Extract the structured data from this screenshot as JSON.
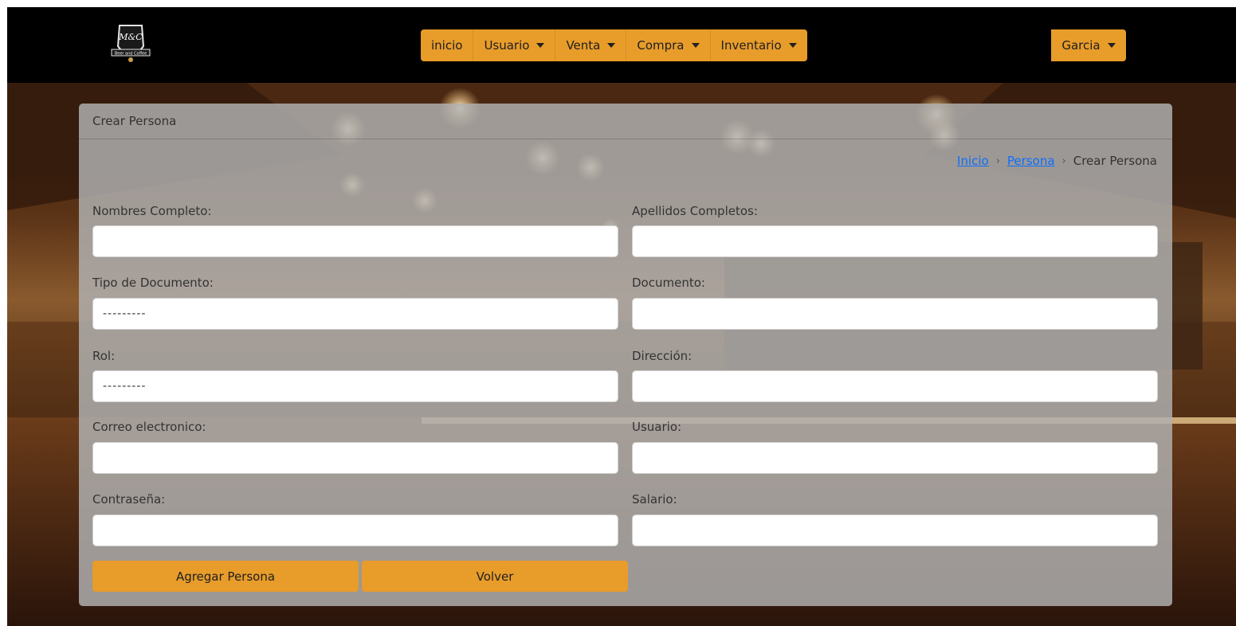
{
  "nav": {
    "items": [
      "inicio",
      "Usuario",
      "Venta",
      "Compra",
      "Inventario"
    ],
    "user_label": "Garcia",
    "accent": "#e89c2a"
  },
  "logo": {
    "text": "M&C",
    "subtext": "Beer and Coffee"
  },
  "card": {
    "header": "Crear Persona",
    "breadcrumb": {
      "home": "Inicio",
      "parent": "Persona",
      "current": "Crear Persona"
    }
  },
  "form": {
    "nombres_label": "Nombres Completo:",
    "apellidos_label": "Apellidos Completos:",
    "tipo_doc_label": "Tipo de Documento:",
    "tipo_doc_value": "---------",
    "documento_label": "Documento:",
    "rol_label": "Rol:",
    "rol_value": "---------",
    "direccion_label": "Dirección:",
    "correo_label": "Correo electronico:",
    "usuario_label": "Usuario:",
    "contrasena_label": "Contraseña:",
    "salario_label": "Salario:"
  },
  "buttons": {
    "agregar": "Agregar Persona",
    "volver": "Volver"
  }
}
